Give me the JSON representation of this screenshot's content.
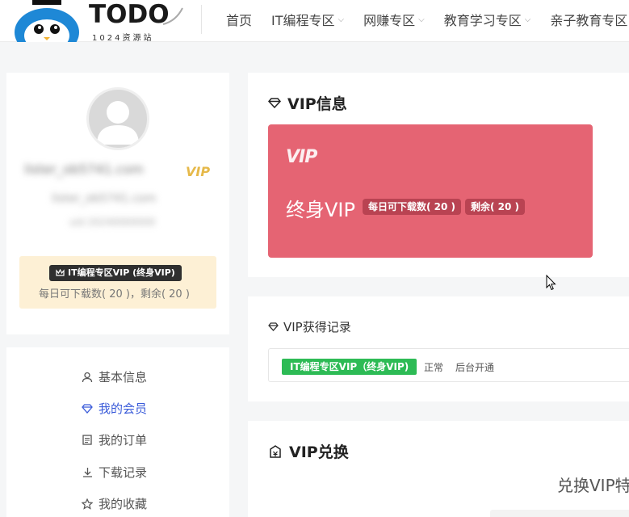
{
  "header": {
    "logo_text": "TODO",
    "logo_sub": "1024资源站",
    "nav": [
      {
        "label": "首页",
        "dropdown": false
      },
      {
        "label": "IT编程专区",
        "dropdown": true
      },
      {
        "label": "网赚专区",
        "dropdown": true
      },
      {
        "label": "教育学习专区",
        "dropdown": true
      },
      {
        "label": "亲子教育专区",
        "dropdown": false
      }
    ]
  },
  "profile": {
    "username_blurred": "lister_ob5741.com",
    "email_blurred": "lister_ob5741.com",
    "extra_blurred": "uid 20240000000",
    "vip_mark": "VIP",
    "vip_badge": "IT编程专区VIP (终身VIP)",
    "vip_quota": "每日可下载数( 20 )，剩余( 20 )"
  },
  "menu": [
    {
      "label": "基本信息",
      "icon": "user-icon",
      "active": false
    },
    {
      "label": "我的会员",
      "icon": "diamond-icon",
      "active": true
    },
    {
      "label": "我的订单",
      "icon": "order-icon",
      "active": false
    },
    {
      "label": "下载记录",
      "icon": "download-icon",
      "active": false
    },
    {
      "label": "我的收藏",
      "icon": "star-icon",
      "active": false
    }
  ],
  "vip_info": {
    "title": "VIP信息",
    "logo": "VIP",
    "level": "终身VIP",
    "daily_limit": "每日可下载数( 20 )",
    "remaining": "剩余( 20 )",
    "color": "#e56473"
  },
  "records": {
    "title": "VIP获得记录",
    "rows": [
      {
        "tag": "IT编程专区VIP（终身VIP)",
        "status": "正常",
        "method": "后台开通"
      }
    ]
  },
  "exchange": {
    "title": "VIP兑换",
    "subtitle": "兑换VIP特"
  },
  "colors": {
    "accent": "#3a5bd9",
    "vip_red": "#e56473",
    "vip_gold": "#e6b94a",
    "green": "#2dbb55"
  }
}
